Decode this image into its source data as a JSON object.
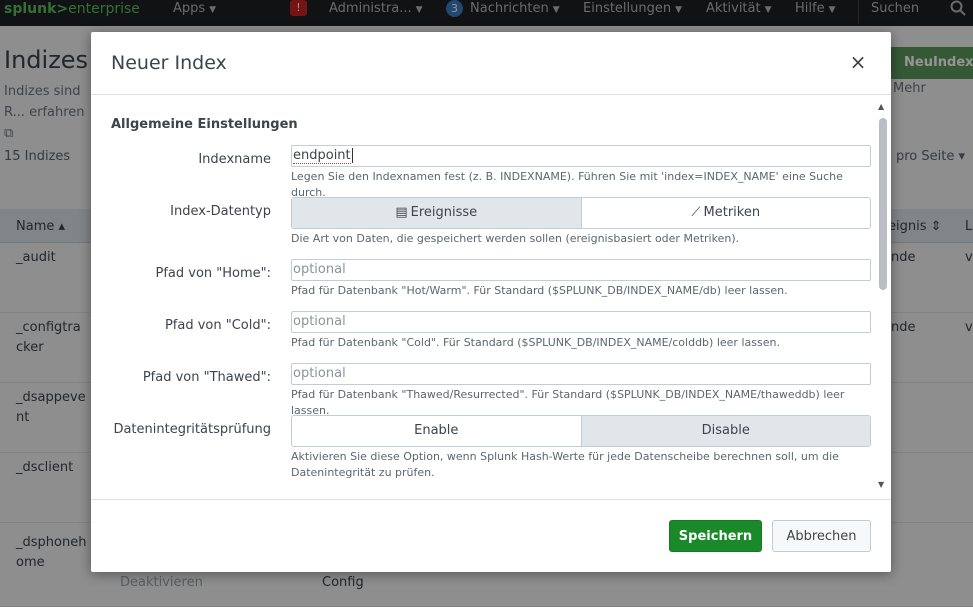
{
  "topbar": {
    "logo_main": "splunk>",
    "logo_sub": "enterprise",
    "apps": "Apps",
    "badge_alert": "!",
    "admin": "Administra...",
    "badge_messages": "3",
    "messages": "Nachrichten",
    "settings": "Einstellungen",
    "activity": "Aktivität",
    "help": "Hilfe",
    "search": "Suchen"
  },
  "page": {
    "title": "Indizes",
    "description": "Indizes sind R... erfahren",
    "more": "Mehr",
    "new_index": "NeuIndex",
    "count": "15 Indizes",
    "per_page": "pro Seite",
    "col_name": "Name",
    "col_events": "eignis",
    "col_l": "L",
    "rows": [
      {
        "name": "_audit",
        "right": "nde",
        "far": "v"
      },
      {
        "name": "_configtracker",
        "right": "nde",
        "far": "v"
      },
      {
        "name": "_dsappevent",
        "right": "",
        "far": ""
      },
      {
        "name": "_dsclient",
        "right": "",
        "far": ""
      },
      {
        "name": "_dsphonehome",
        "right": "",
        "far": ""
      }
    ],
    "bottom_disable": "Deaktivieren",
    "bottom_config": "Config"
  },
  "modal": {
    "title": "Neuer Index",
    "close": "×",
    "section": "Allgemeine Einstellungen",
    "index_name_label": "Indexname",
    "index_name_value": "endpoint",
    "index_name_help": "Legen Sie den Indexnamen fest (z. B. INDEXNAME). Führen Sie mit 'index=INDEX_NAME' eine Suche durch.",
    "datatype_label": "Index-Datentyp",
    "datatype_events": "Ereignisse",
    "datatype_metrics": "Metriken",
    "datatype_help": "Die Art von Daten, die gespeichert werden sollen (ereignisbasiert oder Metriken).",
    "home_label": "Pfad von \"Home\":",
    "home_placeholder": "optional",
    "home_help": "Pfad für Datenbank \"Hot/Warm\". Für Standard ($SPLUNK_DB/INDEX_NAME/db) leer lassen.",
    "cold_label": "Pfad von \"Cold\":",
    "cold_placeholder": "optional",
    "cold_help": "Pfad für Datenbank \"Cold\". Für Standard ($SPLUNK_DB/INDEX_NAME/colddb) leer lassen.",
    "thawed_label": "Pfad von \"Thawed\":",
    "thawed_placeholder": "optional",
    "thawed_help": "Pfad für Datenbank \"Thawed/Resurrected\". Für Standard ($SPLUNK_DB/INDEX_NAME/thaweddb) leer lassen.",
    "integrity_label": "Datenintegritätsprüfung",
    "integrity_enable": "Enable",
    "integrity_disable": "Disable",
    "integrity_help": "Aktivieren Sie diese Option, wenn Splunk Hash-Werte für jede Datenscheibe berechnen soll, um die Datenintegrität zu prüfen.",
    "save": "Speichern",
    "cancel": "Abbrechen"
  },
  "colors": {
    "save_green": "#1a8929",
    "logo_green": "#5cc05c",
    "alert_red": "#cc2222",
    "messages_blue": "#3b7cbf"
  }
}
